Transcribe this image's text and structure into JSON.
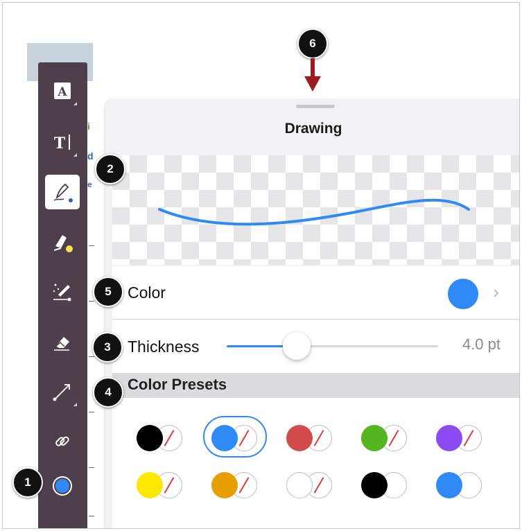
{
  "panel": {
    "title": "Drawing",
    "color_label": "Color",
    "color_value": "#2f8af6",
    "thickness_label": "Thickness",
    "thickness_value": "4.0 pt",
    "thickness_level": 0.33,
    "presets_label": "Color Presets"
  },
  "badges": [
    "1",
    "2",
    "3",
    "4",
    "5",
    "6"
  ],
  "toolbar": {
    "tools": [
      "text-box-icon",
      "text-cursor-icon",
      "pen-icon",
      "highlighter-icon",
      "magic-pen-icon",
      "eraser-icon",
      "arrow-line-icon",
      "link-icon",
      "color-dot-icon"
    ],
    "color_dot": "#2f8af6"
  },
  "presets": [
    {
      "fill": "#000000",
      "stroke": true
    },
    {
      "fill": "#2f8af6",
      "stroke": true,
      "selected": true
    },
    {
      "fill": "#d44b4b",
      "stroke": true
    },
    {
      "fill": "#55b51e",
      "stroke": true
    },
    {
      "fill": "#8c4bf2",
      "stroke": true
    },
    {
      "fill": "#ffe800",
      "stroke": true
    },
    {
      "fill": "#e8a000",
      "stroke": true
    },
    {
      "fill": "#ffffff",
      "stroke": true
    },
    {
      "fill": "#000000",
      "stroke": false
    },
    {
      "fill": "#2f8af6",
      "stroke": false
    }
  ],
  "background_doc": {
    "frag1": "i",
    "frag2": "d",
    "frag3": "e"
  }
}
